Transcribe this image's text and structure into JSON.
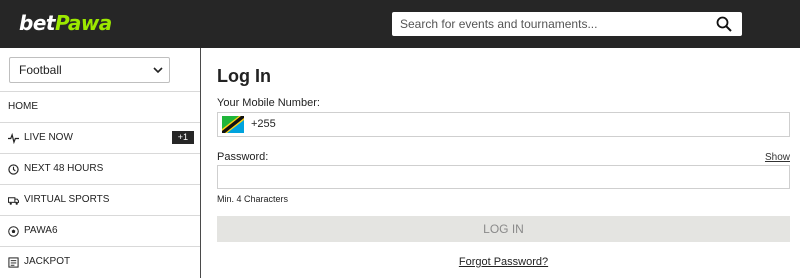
{
  "header": {
    "logo_part1": "bet",
    "logo_part2": "Pawa",
    "search_placeholder": "Search for events and tournaments...",
    "brand_color": "#9ce800",
    "bar_color": "#262626"
  },
  "sidebar": {
    "sport_selected": "Football",
    "items": [
      {
        "label": "HOME",
        "icon": ""
      },
      {
        "label": "LIVE NOW",
        "icon": "pulse-icon",
        "badge": "+1"
      },
      {
        "label": "NEXT 48 HOURS",
        "icon": "clock-icon"
      },
      {
        "label": "VIRTUAL SPORTS",
        "icon": "truck-icon"
      },
      {
        "label": "PAWA6",
        "icon": "soccer-ball-icon"
      },
      {
        "label": "JACKPOT",
        "icon": "ticket-icon"
      }
    ]
  },
  "login": {
    "title": "Log In",
    "mobile_label": "Your Mobile Number:",
    "country_code": "+255",
    "flag_icon": "tanzania-flag-icon",
    "password_label": "Password:",
    "show_label": "Show",
    "hint": "Min. 4 Characters",
    "button_label": "LOG IN",
    "forgot_label": "Forgot Password?"
  }
}
